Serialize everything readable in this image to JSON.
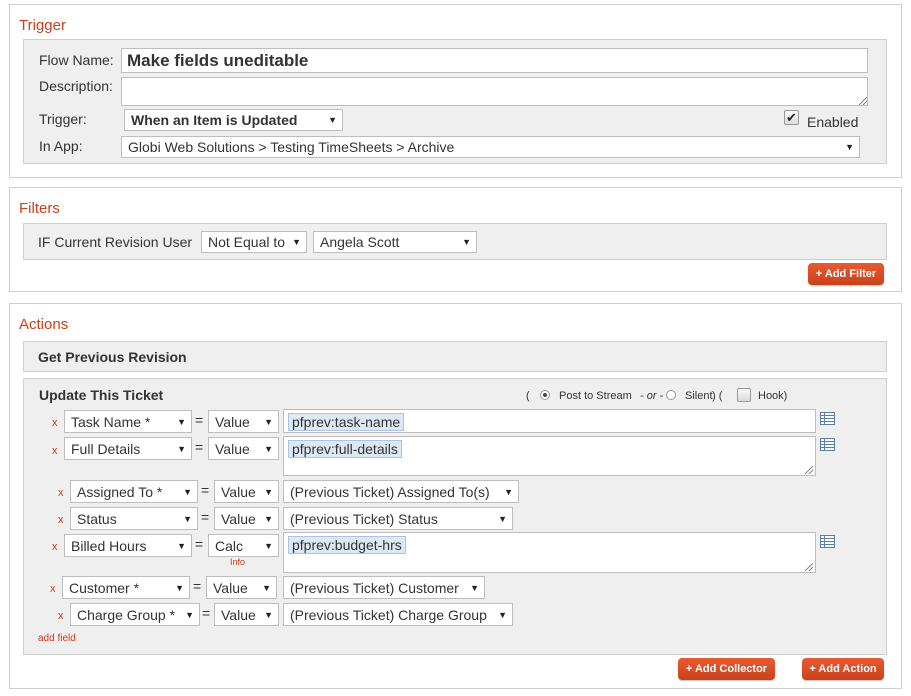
{
  "trigger": {
    "title": "Trigger",
    "flow_name_label": "Flow Name:",
    "flow_name_value": "Make fields uneditable",
    "description_label": "Description:",
    "description_value": "",
    "trigger_label": "Trigger:",
    "trigger_value": "When an Item is Updated",
    "enabled_label": "Enabled",
    "enabled_checked": true,
    "in_app_label": "In App:",
    "in_app_value": "Globi Web Solutions > Testing TimeSheets > Archive"
  },
  "filters": {
    "title": "Filters",
    "condition_label": "IF Current Revision User",
    "operator_value": "Not Equal to",
    "user_value": "Angela Scott",
    "add_filter_button": "+ Add Filter"
  },
  "actions": {
    "title": "Actions",
    "get_previous_revision": "Get Previous Revision",
    "update_ticket": {
      "title": "Update This Ticket",
      "paren_open": "(",
      "post_to_stream": "Post to Stream",
      "or_text": "- or -",
      "silent": "Silent",
      "paren_mid": ") (",
      "hook": "Hook)",
      "rows": [
        {
          "remove": "x",
          "field": "Task Name *",
          "eq": "=",
          "mode": "Value",
          "value": "pfprev:task-name"
        },
        {
          "remove": "x",
          "field": "Full Details",
          "eq": "=",
          "mode": "Value",
          "value": "pfprev:full-details"
        },
        {
          "remove": "x",
          "field": "Assigned To *",
          "eq": "=",
          "mode": "Value",
          "value": "(Previous Ticket) Assigned To(s)"
        },
        {
          "remove": "x",
          "field": "Status",
          "eq": "=",
          "mode": "Value",
          "value": "(Previous Ticket) Status"
        },
        {
          "remove": "x",
          "field": "Billed Hours",
          "eq": "=",
          "mode": "Calc",
          "mode_info": "Info",
          "value": "pfprev:budget-hrs"
        },
        {
          "remove": "x",
          "field": "Customer *",
          "eq": "=",
          "mode": "Value",
          "value": "(Previous Ticket) Customer"
        },
        {
          "remove": "x",
          "field": "Charge Group *",
          "eq": "=",
          "mode": "Value",
          "value": "(Previous Ticket) Charge Group"
        }
      ],
      "add_field": "add field"
    },
    "add_collector_button": "+ Add Collector",
    "add_action_button": "+ Add Action"
  },
  "colors": {
    "accent": "#c7421b",
    "panel_bg": "#efefef",
    "tag_bg": "#dde8f5"
  },
  "icons": {
    "caret": "caret-down-icon",
    "grid": "data-grid-icon",
    "resize": "resize-handle-icon"
  }
}
